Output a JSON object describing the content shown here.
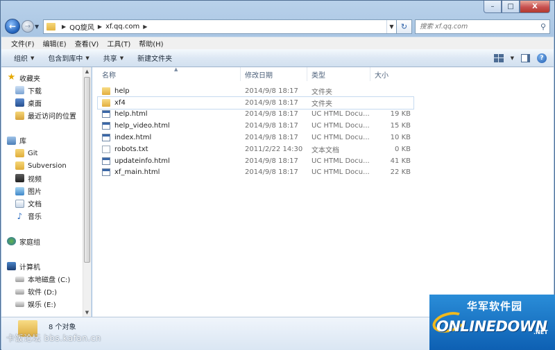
{
  "caption": {
    "minimize": "–",
    "maximize": "□",
    "close": "X"
  },
  "address": {
    "crumbs": [
      "QQ旋风",
      "xf.qq.com"
    ],
    "search_placeholder": "搜索 xf.qq.com"
  },
  "menu": [
    "文件(F)",
    "编辑(E)",
    "查看(V)",
    "工具(T)",
    "帮助(H)"
  ],
  "commands": [
    {
      "label": "组织",
      "dropdown": true
    },
    {
      "label": "包含到库中",
      "dropdown": true
    },
    {
      "label": "共享",
      "dropdown": true
    },
    {
      "label": "新建文件夹",
      "dropdown": false
    }
  ],
  "nav": {
    "favorites": {
      "label": "收藏夹",
      "items": [
        "下载",
        "桌面",
        "最近访问的位置"
      ]
    },
    "libraries": {
      "label": "库",
      "items": [
        "Git",
        "Subversion",
        "视频",
        "图片",
        "文档",
        "音乐"
      ]
    },
    "homegroup": "家庭组",
    "computer": {
      "label": "计算机",
      "items": [
        "本地磁盘 (C:)",
        "软件 (D:)",
        "娱乐 (E:)"
      ]
    }
  },
  "columns": {
    "name": "名称",
    "date": "修改日期",
    "type": "类型",
    "size": "大小"
  },
  "files": [
    {
      "name": "help",
      "date": "2014/9/8 18:17",
      "type": "文件夹",
      "size": "",
      "icon": "folder-icon"
    },
    {
      "name": "xf4",
      "date": "2014/9/8 18:17",
      "type": "文件夹",
      "size": "",
      "icon": "folder-icon"
    },
    {
      "name": "help.html",
      "date": "2014/9/8 18:17",
      "type": "UC HTML Docu...",
      "size": "19 KB",
      "icon": "html-file-icon"
    },
    {
      "name": "help_video.html",
      "date": "2014/9/8 18:17",
      "type": "UC HTML Docu...",
      "size": "15 KB",
      "icon": "html-file-icon"
    },
    {
      "name": "index.html",
      "date": "2014/9/8 18:17",
      "type": "UC HTML Docu...",
      "size": "10 KB",
      "icon": "html-file-icon"
    },
    {
      "name": "robots.txt",
      "date": "2011/2/22 14:30",
      "type": "文本文档",
      "size": "0 KB",
      "icon": "text-file-icon"
    },
    {
      "name": "updateinfo.html",
      "date": "2014/9/8 18:17",
      "type": "UC HTML Docu...",
      "size": "41 KB",
      "icon": "html-file-icon"
    },
    {
      "name": "xf_main.html",
      "date": "2014/9/8 18:17",
      "type": "UC HTML Docu...",
      "size": "22 KB",
      "icon": "html-file-icon"
    }
  ],
  "status": {
    "count": "8 个对象"
  },
  "watermarks": {
    "left": "卡饭论坛 bbs.kafan.cn",
    "logo_cn": "华军软件园",
    "logo_brand": "ONLINEDOWN",
    "logo_net": ".NET"
  }
}
